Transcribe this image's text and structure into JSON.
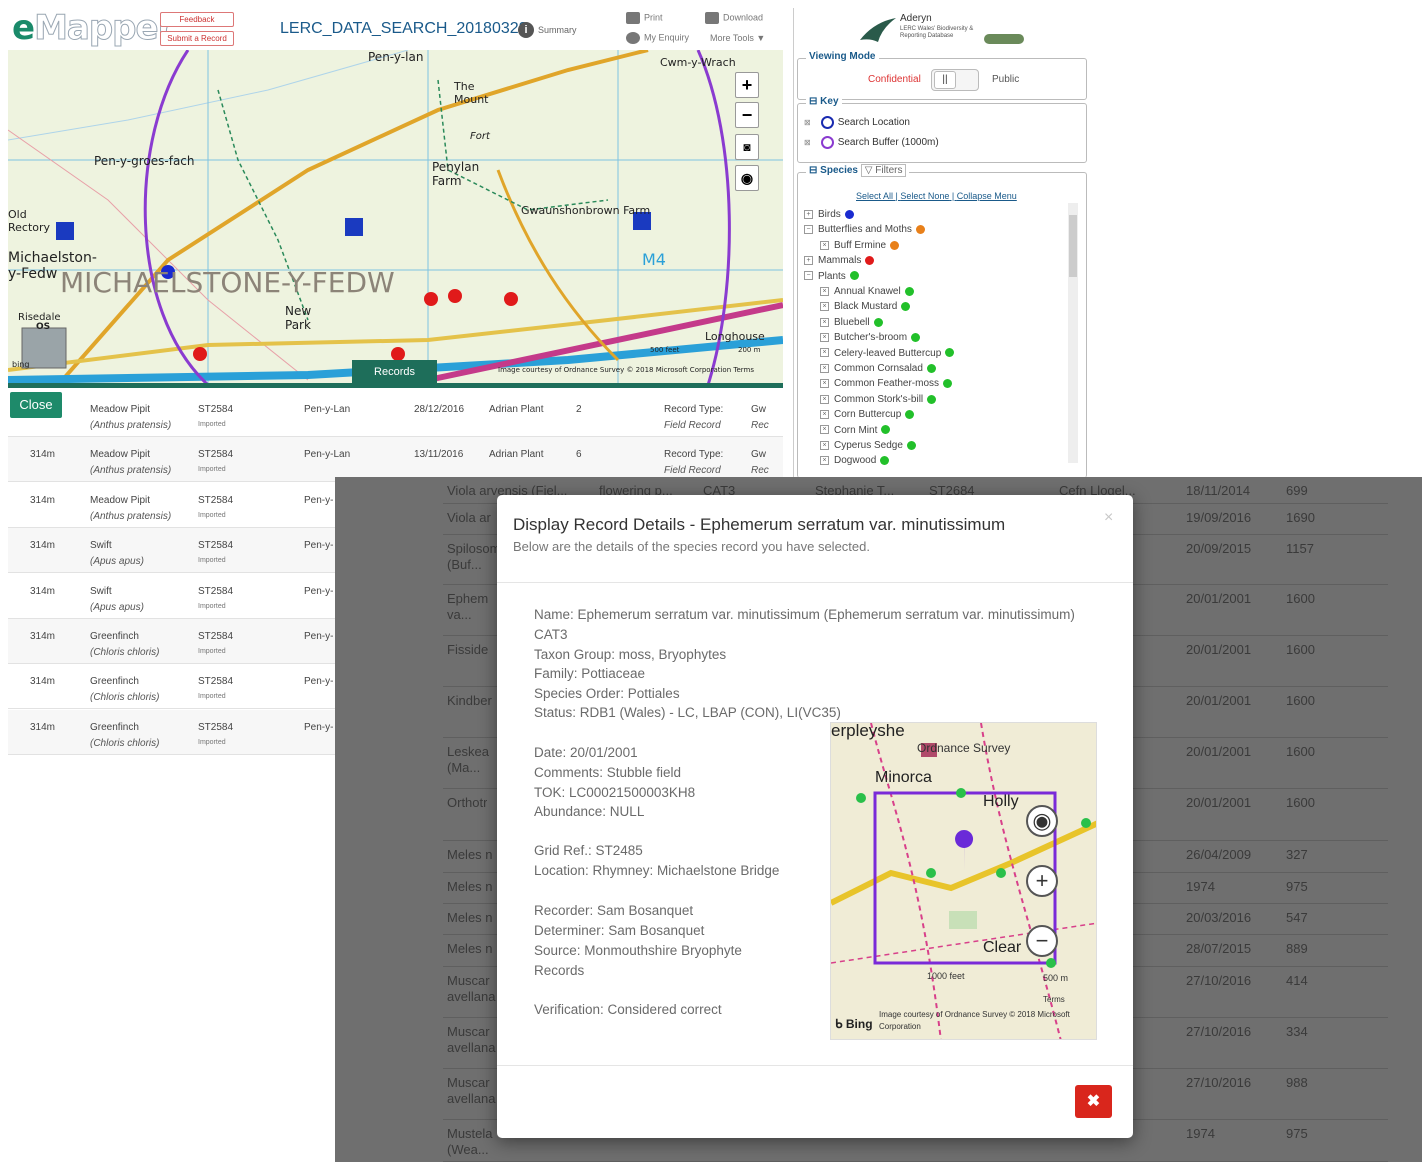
{
  "app": {
    "logo_e": "e",
    "logo_rest": "Mapper",
    "feedback": "Feedback",
    "submit": "Submit a Record",
    "search_title": "LERC_DATA_SEARCH_20180328",
    "summary": "Summary",
    "print": "Print",
    "download": "Download",
    "my_enquiry": "My Enquiry",
    "more_tools": "More Tools ▼"
  },
  "map": {
    "labels": [
      "Pen-y-lan",
      "Cwm-y-Wrach",
      "The Mount",
      "Fort",
      "Pen-y-groes-fach",
      "Penylan Farm",
      "Old Rectory",
      "Gwaunshonbrown Farm",
      "Michaelston-y-Fedw",
      "MICHAELSTONE-Y-FEDW",
      "New Park",
      "Risedale",
      "Longhouse",
      "M4",
      "OS"
    ],
    "records_tab": "Records",
    "attribution": "Image courtesy of Ordnance Survey © 2018 Microsoft Corporation Terms",
    "scale": "500 feet",
    "scale_m": "200 m",
    "bing": "bing"
  },
  "panel": {
    "brand": "Aderyn",
    "brand_sub": "LERC Wales' Biodiversity & Reporting Database",
    "viewing_mode": "Viewing Mode",
    "confidential": "Confidential",
    "public": "Public",
    "key": "Key",
    "key_items": [
      {
        "label": "Search Location",
        "color": "#1a2bb0"
      },
      {
        "label": "Search Buffer (1000m)",
        "color": "#8a3bd0"
      }
    ],
    "species": "Species",
    "filters": "Filters",
    "select_all": "Select All",
    "select_none": "Select None",
    "collapse": "Collapse Menu",
    "groups": [
      {
        "label": "Birds",
        "color": "#1a2bd0",
        "level": 0,
        "sign": "+"
      },
      {
        "label": "Butterflies and Moths",
        "color": "#e8801a",
        "level": 0,
        "sign": "−"
      },
      {
        "label": "Buff Ermine",
        "color": "#e8801a",
        "level": 1,
        "sign": "×"
      },
      {
        "label": "Mammals",
        "color": "#e01a1a",
        "level": 0,
        "sign": "+"
      },
      {
        "label": "Plants",
        "color": "#22c02a",
        "level": 0,
        "sign": "−"
      },
      {
        "label": "Annual Knawel",
        "color": "#22c02a",
        "level": 1,
        "sign": "×"
      },
      {
        "label": "Black Mustard",
        "color": "#22c02a",
        "level": 1,
        "sign": "×"
      },
      {
        "label": "Bluebell",
        "color": "#22c02a",
        "level": 1,
        "sign": "×"
      },
      {
        "label": "Butcher's-broom",
        "color": "#22c02a",
        "level": 1,
        "sign": "×"
      },
      {
        "label": "Celery-leaved Buttercup",
        "color": "#22c02a",
        "level": 1,
        "sign": "×"
      },
      {
        "label": "Common Cornsalad",
        "color": "#22c02a",
        "level": 1,
        "sign": "×"
      },
      {
        "label": "Common Feather-moss",
        "color": "#22c02a",
        "level": 1,
        "sign": "×"
      },
      {
        "label": "Common Stork's-bill",
        "color": "#22c02a",
        "level": 1,
        "sign": "×"
      },
      {
        "label": "Corn Buttercup",
        "color": "#22c02a",
        "level": 1,
        "sign": "×"
      },
      {
        "label": "Corn Mint",
        "color": "#22c02a",
        "level": 1,
        "sign": "×"
      },
      {
        "label": "Cyperus Sedge",
        "color": "#22c02a",
        "level": 1,
        "sign": "×"
      },
      {
        "label": "Dogwood",
        "color": "#22c02a",
        "level": 1,
        "sign": "×"
      }
    ]
  },
  "records": {
    "close": "Close",
    "rows": [
      {
        "dist": "",
        "name": "Meadow Pipit",
        "latin": "(Anthus pratensis)",
        "grid": "ST2584",
        "imp": "Imported",
        "loc": "Pen-y-Lan",
        "date": "28/12/2016",
        "rec": "Adrian Plant",
        "num": "2",
        "rtype": "Record Type:",
        "rtype2": "Field Record",
        "ex": "Gw",
        "ex2": "Rec"
      },
      {
        "dist": "314m",
        "name": "Meadow Pipit",
        "latin": "(Anthus pratensis)",
        "grid": "ST2584",
        "imp": "Imported",
        "loc": "Pen-y-Lan",
        "date": "13/11/2016",
        "rec": "Adrian Plant",
        "num": "6",
        "rtype": "Record Type:",
        "rtype2": "Field Record",
        "ex": "Gw",
        "ex2": "Rec"
      },
      {
        "dist": "314m",
        "name": "Meadow Pipit",
        "latin": "(Anthus pratensis)",
        "grid": "ST2584",
        "imp": "Imported",
        "loc": "Pen-y-",
        "date": "",
        "rec": "",
        "num": "",
        "rtype": "",
        "rtype2": "",
        "ex": "",
        "ex2": ""
      },
      {
        "dist": "314m",
        "name": "Swift",
        "latin": "(Apus apus)",
        "grid": "ST2584",
        "imp": "Imported",
        "loc": "Pen-y-",
        "date": "",
        "rec": "",
        "num": "",
        "rtype": "",
        "rtype2": "",
        "ex": "",
        "ex2": ""
      },
      {
        "dist": "314m",
        "name": "Swift",
        "latin": "(Apus apus)",
        "grid": "ST2584",
        "imp": "Imported",
        "loc": "Pen-y-",
        "date": "",
        "rec": "",
        "num": "",
        "rtype": "",
        "rtype2": "",
        "ex": "",
        "ex2": ""
      },
      {
        "dist": "314m",
        "name": "Greenfinch",
        "latin": "(Chloris chloris)",
        "grid": "ST2584",
        "imp": "Imported",
        "loc": "Pen-y-",
        "date": "",
        "rec": "",
        "num": "",
        "rtype": "",
        "rtype2": "",
        "ex": "",
        "ex2": ""
      },
      {
        "dist": "314m",
        "name": "Greenfinch",
        "latin": "(Chloris chloris)",
        "grid": "ST2584",
        "imp": "Imported",
        "loc": "Pen-y-",
        "date": "",
        "rec": "",
        "num": "",
        "rtype": "",
        "rtype2": "",
        "ex": "",
        "ex2": ""
      },
      {
        "dist": "314m",
        "name": "Greenfinch",
        "latin": "(Chloris chloris)",
        "grid": "ST2584",
        "imp": "Imported",
        "loc": "Pen-y-",
        "date": "",
        "rec": "",
        "num": "",
        "rtype": "",
        "rtype2": "",
        "ex": "",
        "ex2": ""
      }
    ]
  },
  "background_table": {
    "rows": [
      {
        "a": "Viola arvensis (Fiel...",
        "b": "flowering p...",
        "c": "CAT3",
        "d": "Stephanie T...",
        "e": "ST2684",
        "f": "Cefn Llogel...",
        "g": "18/11/2014",
        "h": "699"
      },
      {
        "a": "Viola ar",
        "g": "19/09/2016",
        "h": "1690"
      },
      {
        "a": "Spilosom",
        "a2": "(Buf...",
        "g": "20/09/2015",
        "h": "1157"
      },
      {
        "a": "Ephem",
        "a2": "va...",
        "f": "Mi...",
        "g": "20/01/2001",
        "h": "1600"
      },
      {
        "a": "Fisside",
        "f": "Mi...",
        "g": "20/01/2001",
        "h": "1600"
      },
      {
        "a": "Kindber",
        "f": "Mi...",
        "g": "20/01/2001",
        "h": "1600"
      },
      {
        "a": "Leskea",
        "a2": "(Ma...",
        "f": "Mi...",
        "g": "20/01/2001",
        "h": "1600"
      },
      {
        "a": "Orthotr",
        "f": "Mi...",
        "g": "20/01/2001",
        "h": "1600"
      },
      {
        "a": "Meles n",
        "g": "26/04/2009",
        "h": "327"
      },
      {
        "a": "Meles n",
        "g": "1974",
        "h": "975"
      },
      {
        "a": "Meles n",
        "g": "20/03/2016",
        "h": "547"
      },
      {
        "a": "Meles n",
        "g": "28/07/2015",
        "h": "889"
      },
      {
        "a": "Muscar",
        "a2": "avellana",
        "g": "27/10/2016",
        "h": "414"
      },
      {
        "a": "Muscar",
        "a2": "avellana",
        "g": "27/10/2016",
        "h": "334"
      },
      {
        "a": "Muscar",
        "a2": "avellana",
        "g": "27/10/2016",
        "h": "988"
      },
      {
        "a": "Mustela",
        "a2": "(Wea...",
        "g": "1974",
        "h": "975"
      }
    ]
  },
  "modal": {
    "title": "Display Record Details - Ephemerum serratum var. minutissimum",
    "subtitle": "Below are the details of the species record you have selected.",
    "close_x": "×",
    "details": [
      "Name: Ephemerum serratum var. minutissimum (Ephemerum serratum var. minutissimum)",
      "CAT3",
      "Taxon Group: moss, Bryophytes",
      "Family: Pottiaceae",
      "Species Order: Pottiales",
      "Status: RDB1 (Wales) - LC, LBAP (CON), LI(VC35)",
      "Date: 20/01/2001",
      "Comments: Stubble field",
      "TOK: LC00021500003KH8",
      "Abundance: NULL",
      "Grid Ref.: ST2485",
      "Location: Rhymney: Michaelstone Bridge",
      "Recorder: Sam Bosanquet",
      "Determiner: Sam Bosanquet",
      "Source: Monmouthshire Bryophyte",
      "Records",
      "Verification: Considered correct"
    ],
    "map": {
      "os": "Ordnance Survey",
      "labels": [
        "erpleyshe",
        "Minorca",
        "Holly",
        "Clear"
      ],
      "scale_ft": "1000 feet",
      "scale_m": "500 m",
      "terms": "Terms",
      "attribution": "Image courtesy of Ordnance Survey © 2018 Microsoft Corporation",
      "bing": "Bing"
    },
    "delete": "✖"
  }
}
